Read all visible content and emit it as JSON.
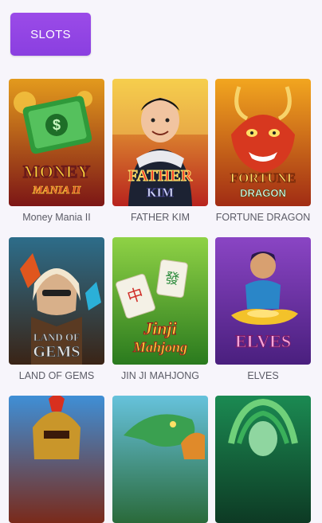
{
  "header": {
    "slots_label": "SLOTS"
  },
  "games": [
    {
      "title": "Money Mania II",
      "art_text": "MONEY",
      "art_sub": "MANIA II",
      "bg_top": "#e0a11a",
      "bg_bottom": "#8b1c1c",
      "icon": "money-mania-art-icon"
    },
    {
      "title": "FATHER KIM",
      "art_text": "FATHER",
      "art_sub": "KIM",
      "bg_top": "#f3c12b",
      "bg_bottom": "#b21e1e",
      "icon": "father-kim-art-icon"
    },
    {
      "title": "FORTUNE DRAGON",
      "art_text": "FORTUNE",
      "art_sub": "DRAGON",
      "bg_top": "#f0a31c",
      "bg_bottom": "#9a2a12",
      "icon": "fortune-dragon-art-icon"
    },
    {
      "title": "LAND OF GEMS",
      "art_text": "LAND OF",
      "art_sub": "GEMS",
      "bg_top": "#2c6a86",
      "bg_bottom": "#3b2416",
      "icon": "land-of-gems-art-icon"
    },
    {
      "title": "JIN JI MAHJONG",
      "art_text": "Jinji",
      "art_sub": "Mahjong",
      "bg_top": "#7ac43a",
      "bg_bottom": "#2a7a1e",
      "icon": "jinji-mahjong-art-icon"
    },
    {
      "title": "ELVES",
      "art_text": "ELVES",
      "art_sub": "",
      "bg_top": "#7a3bb8",
      "bg_bottom": "#4a1f7e",
      "icon": "elves-art-icon"
    },
    {
      "title": "",
      "art_text": "",
      "art_sub": "",
      "bg_top": "#3f8fd6",
      "bg_bottom": "#7a2a1a",
      "icon": "warrior-art-icon"
    },
    {
      "title": "",
      "art_text": "",
      "art_sub": "",
      "bg_top": "#5db8d8",
      "bg_bottom": "#2a6a3a",
      "icon": "green-dragon-art-icon"
    },
    {
      "title": "",
      "art_text": "",
      "art_sub": "",
      "bg_top": "#1a7a4a",
      "bg_bottom": "#0d3a24",
      "icon": "medusa-art-icon"
    }
  ]
}
